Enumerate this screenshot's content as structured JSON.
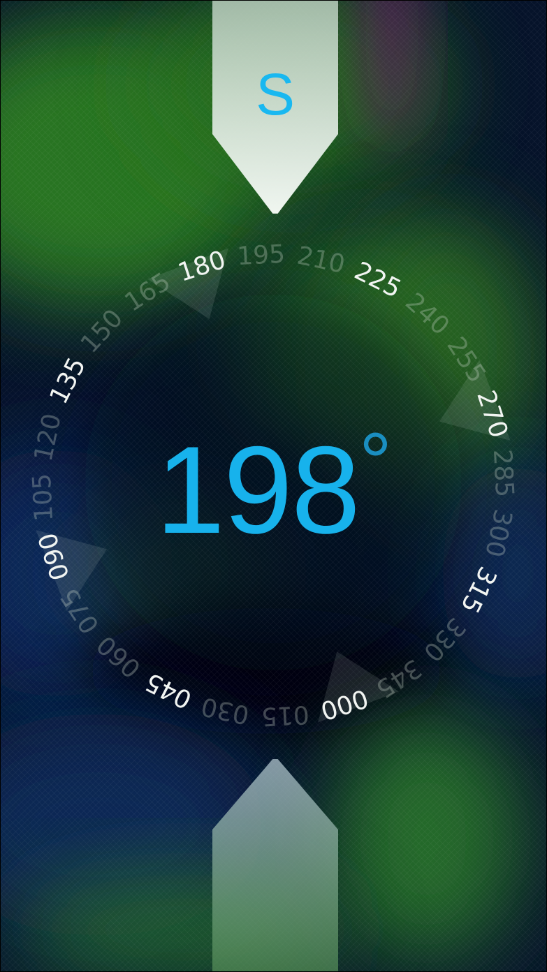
{
  "compass": {
    "cardinal_direction": "S",
    "heading_value": "198",
    "heading_unit": "°",
    "heading_degrees": 198
  },
  "dial_ticks": [
    {
      "label": "180",
      "bearing": 180,
      "major": true
    },
    {
      "label": "195",
      "bearing": 195,
      "major": false
    },
    {
      "label": "210",
      "bearing": 210,
      "major": false
    },
    {
      "label": "225",
      "bearing": 225,
      "major": true
    },
    {
      "label": "240",
      "bearing": 240,
      "major": false
    },
    {
      "label": "255",
      "bearing": 255,
      "major": false
    },
    {
      "label": "270",
      "bearing": 270,
      "major": true
    },
    {
      "label": "285",
      "bearing": 285,
      "major": false
    },
    {
      "label": "300",
      "bearing": 300,
      "major": false
    },
    {
      "label": "315",
      "bearing": 315,
      "major": true
    },
    {
      "label": "330",
      "bearing": 330,
      "major": false
    },
    {
      "label": "345",
      "bearing": 345,
      "major": false
    },
    {
      "label": "000",
      "bearing": 0,
      "major": true
    },
    {
      "label": "015",
      "bearing": 15,
      "major": false
    },
    {
      "label": "030",
      "bearing": 30,
      "major": false
    },
    {
      "label": "045",
      "bearing": 45,
      "major": true
    },
    {
      "label": "060",
      "bearing": 60,
      "major": false
    },
    {
      "label": "075",
      "bearing": 75,
      "major": false
    },
    {
      "label": "090",
      "bearing": 90,
      "major": true
    },
    {
      "label": "105",
      "bearing": 105,
      "major": false
    },
    {
      "label": "120",
      "bearing": 120,
      "major": false
    },
    {
      "label": "135",
      "bearing": 135,
      "major": true
    },
    {
      "label": "150",
      "bearing": 150,
      "major": false
    },
    {
      "label": "165",
      "bearing": 165,
      "major": false
    }
  ],
  "colors": {
    "accent": "#17b2ec",
    "major_tick": "#f2f5f2",
    "minor_tick": "rgba(200,210,200,0.32)"
  }
}
